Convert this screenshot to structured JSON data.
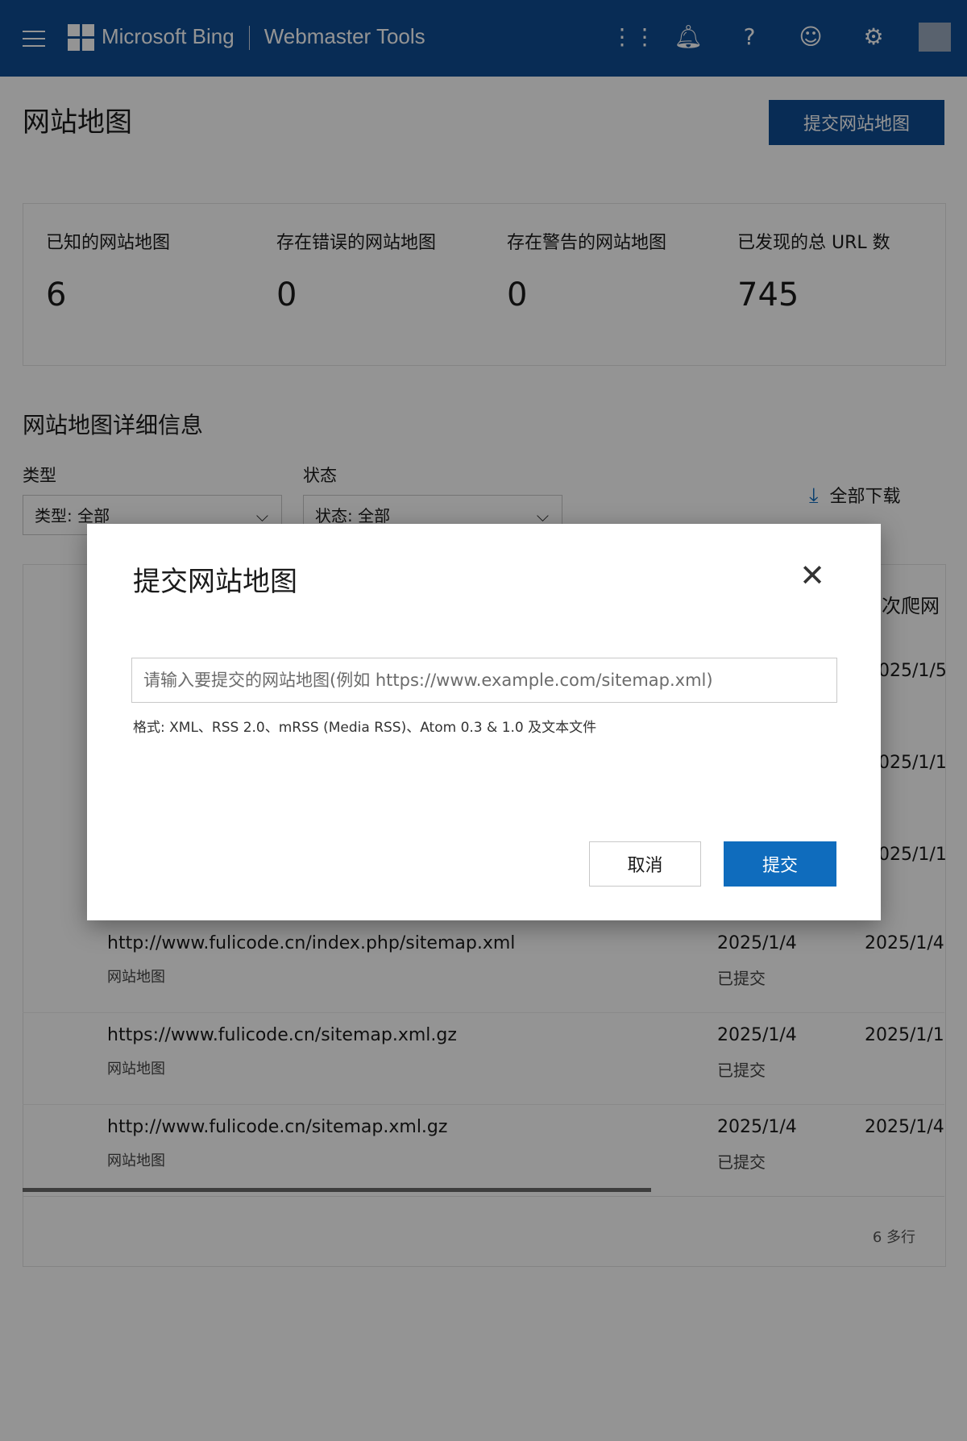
{
  "header": {
    "brand": "Microsoft Bing",
    "product": "Webmaster Tools",
    "icons": [
      "apps-grid-icon",
      "bell-icon",
      "help-icon",
      "smiley-icon",
      "gear-icon"
    ]
  },
  "page": {
    "title": "网站地图",
    "submit_button": "提交网站地图"
  },
  "stats": [
    {
      "label": "已知的网站地图",
      "value": "6"
    },
    {
      "label": "存在错误的网站地图",
      "value": "0"
    },
    {
      "label": "存在警告的网站地图",
      "value": "0"
    },
    {
      "label": "已发现的总 URL 数",
      "value": "745"
    }
  ],
  "details": {
    "title": "网站地图详细信息",
    "type_label": "类型",
    "type_value": "类型: 全部",
    "status_label": "状态",
    "status_value": "状态: 全部",
    "download": "全部下载",
    "column_last_crawl": "次爬网",
    "hidden_dates": [
      "025/1/5",
      "025/1/1",
      "025/1/1"
    ],
    "rows": [
      {
        "url": "http://www.fulicode.cn/index.php/sitemap.xml",
        "type": "网站地图",
        "submitted": "2025/1/4",
        "status": "已提交",
        "crawled": "2025/1/4"
      },
      {
        "url": "https://www.fulicode.cn/sitemap.xml.gz",
        "type": "网站地图",
        "submitted": "2025/1/4",
        "status": "已提交",
        "crawled": "2025/1/1"
      },
      {
        "url": "http://www.fulicode.cn/sitemap.xml.gz",
        "type": "网站地图",
        "submitted": "2025/1/4",
        "status": "已提交",
        "crawled": "2025/1/4"
      }
    ],
    "row_count": "6 多行"
  },
  "modal": {
    "title": "提交网站地图",
    "placeholder": "请输入要提交的网站地图(例如 https://www.example.com/sitemap.xml)",
    "hint": "格式: XML、RSS 2.0、mRSS (Media RSS)、Atom 0.3 & 1.0 及文本文件",
    "cancel": "取消",
    "submit": "提交"
  },
  "colors": {
    "header": "#0f4c93",
    "primary": "#0f6cbd"
  }
}
